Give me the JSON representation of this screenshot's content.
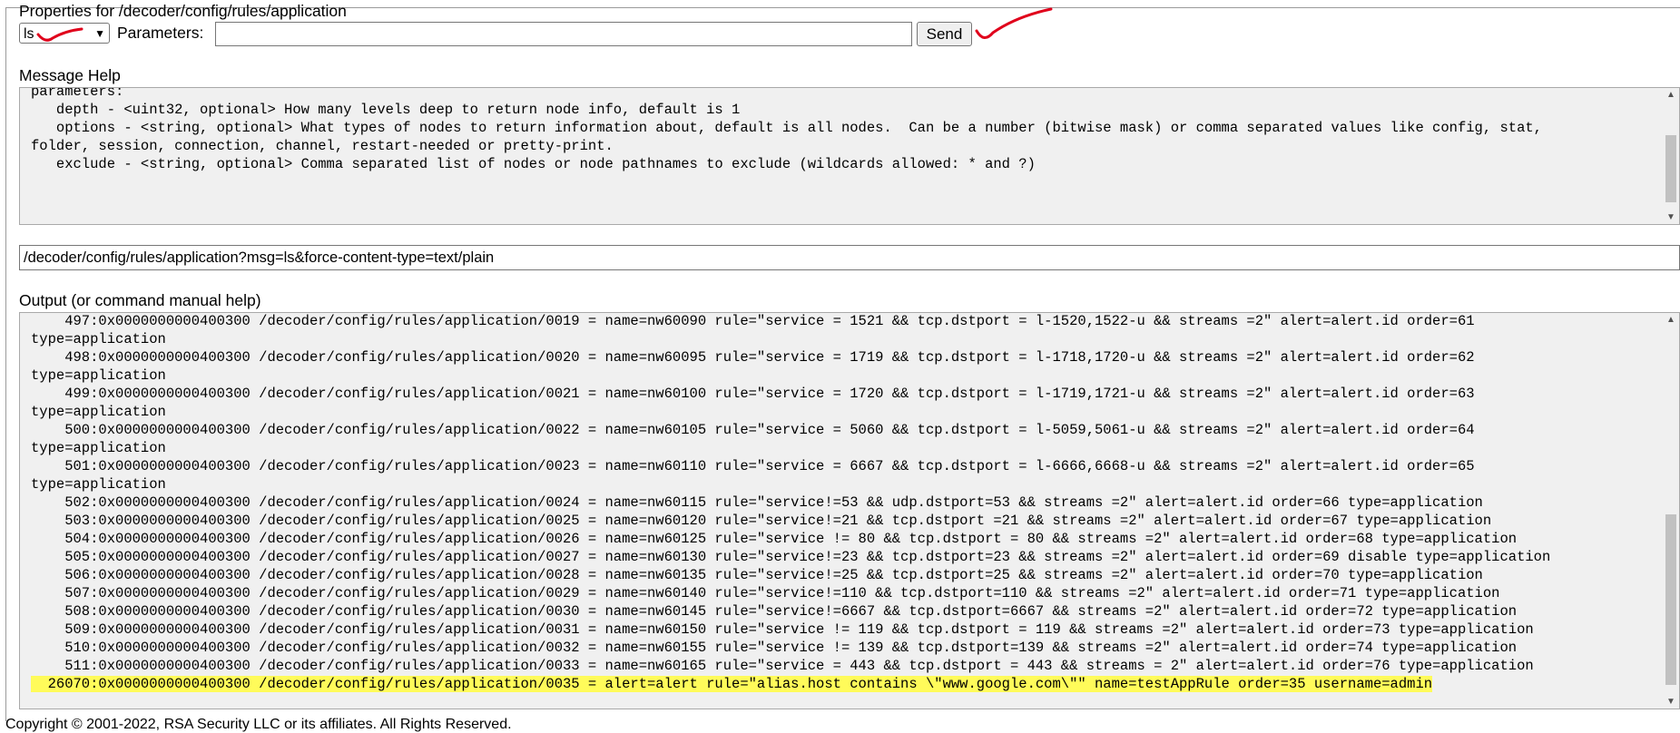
{
  "properties_title": "Properties for /decoder/config/rules/application",
  "form": {
    "message_select": "ls",
    "parameters_label": "Parameters:",
    "parameters_value": "",
    "send_label": "Send"
  },
  "help": {
    "title": "Message Help",
    "lines": [
      "parameters:",
      "   depth - <uint32, optional> How many levels deep to return node info, default is 1",
      "   options - <string, optional> What types of nodes to return information about, default is all nodes.  Can be a number (bitwise mask) or comma separated values like config, stat,",
      "folder, session, connection, channel, restart-needed or pretty-print.",
      "   exclude - <string, optional> Comma separated list of nodes or node pathnames to exclude (wildcards allowed: * and ?)"
    ]
  },
  "url_field": "/decoder/config/rules/application?msg=ls&force-content-type=text/plain",
  "output": {
    "title": "Output (or command manual help)",
    "lines": [
      "    497:0x0000000000400300 /decoder/config/rules/application/0019 = name=nw60090 rule=\"service = 1521 && tcp.dstport = l-1520,1522-u && streams =2\" alert=alert.id order=61",
      "type=application",
      "    498:0x0000000000400300 /decoder/config/rules/application/0020 = name=nw60095 rule=\"service = 1719 && tcp.dstport = l-1718,1720-u && streams =2\" alert=alert.id order=62",
      "type=application",
      "    499:0x0000000000400300 /decoder/config/rules/application/0021 = name=nw60100 rule=\"service = 1720 && tcp.dstport = l-1719,1721-u && streams =2\" alert=alert.id order=63",
      "type=application",
      "    500:0x0000000000400300 /decoder/config/rules/application/0022 = name=nw60105 rule=\"service = 5060 && tcp.dstport = l-5059,5061-u && streams =2\" alert=alert.id order=64",
      "type=application",
      "    501:0x0000000000400300 /decoder/config/rules/application/0023 = name=nw60110 rule=\"service = 6667 && tcp.dstport = l-6666,6668-u && streams =2\" alert=alert.id order=65",
      "type=application",
      "    502:0x0000000000400300 /decoder/config/rules/application/0024 = name=nw60115 rule=\"service!=53 && udp.dstport=53 && streams =2\" alert=alert.id order=66 type=application",
      "    503:0x0000000000400300 /decoder/config/rules/application/0025 = name=nw60120 rule=\"service!=21 && tcp.dstport =21 && streams =2\" alert=alert.id order=67 type=application",
      "    504:0x0000000000400300 /decoder/config/rules/application/0026 = name=nw60125 rule=\"service != 80 && tcp.dstport = 80 && streams =2\" alert=alert.id order=68 type=application",
      "    505:0x0000000000400300 /decoder/config/rules/application/0027 = name=nw60130 rule=\"service!=23 && tcp.dstport=23 && streams =2\" alert=alert.id order=69 disable type=application",
      "    506:0x0000000000400300 /decoder/config/rules/application/0028 = name=nw60135 rule=\"service!=25 && tcp.dstport=25 && streams =2\" alert=alert.id order=70 type=application",
      "    507:0x0000000000400300 /decoder/config/rules/application/0029 = name=nw60140 rule=\"service!=110 && tcp.dstport=110 && streams =2\" alert=alert.id order=71 type=application",
      "    508:0x0000000000400300 /decoder/config/rules/application/0030 = name=nw60145 rule=\"service!=6667 && tcp.dstport=6667 && streams =2\" alert=alert.id order=72 type=application",
      "    509:0x0000000000400300 /decoder/config/rules/application/0031 = name=nw60150 rule=\"service != 119 && tcp.dstport = 119 && streams =2\" alert=alert.id order=73 type=application",
      "    510:0x0000000000400300 /decoder/config/rules/application/0032 = name=nw60155 rule=\"service != 139 && tcp.dstport=139 && streams =2\" alert=alert.id order=74 type=application",
      "    511:0x0000000000400300 /decoder/config/rules/application/0033 = name=nw60165 rule=\"service = 443 && tcp.dstport = 443 && streams = 2\" alert=alert.id order=76 type=application"
    ],
    "highlighted_line": "  26070:0x0000000000400300 /decoder/config/rules/application/0035 = alert=alert rule=\"alias.host contains \\\"www.google.com\\\"\" name=testAppRule order=35 username=admin"
  },
  "footer": "Copyright © 2001-2022, RSA Security LLC or its affiliates. All Rights Reserved.",
  "colors": {
    "highlight": "#fffb5a",
    "check_mark": "#e0001b",
    "pane_bg": "#f0f0f0"
  }
}
